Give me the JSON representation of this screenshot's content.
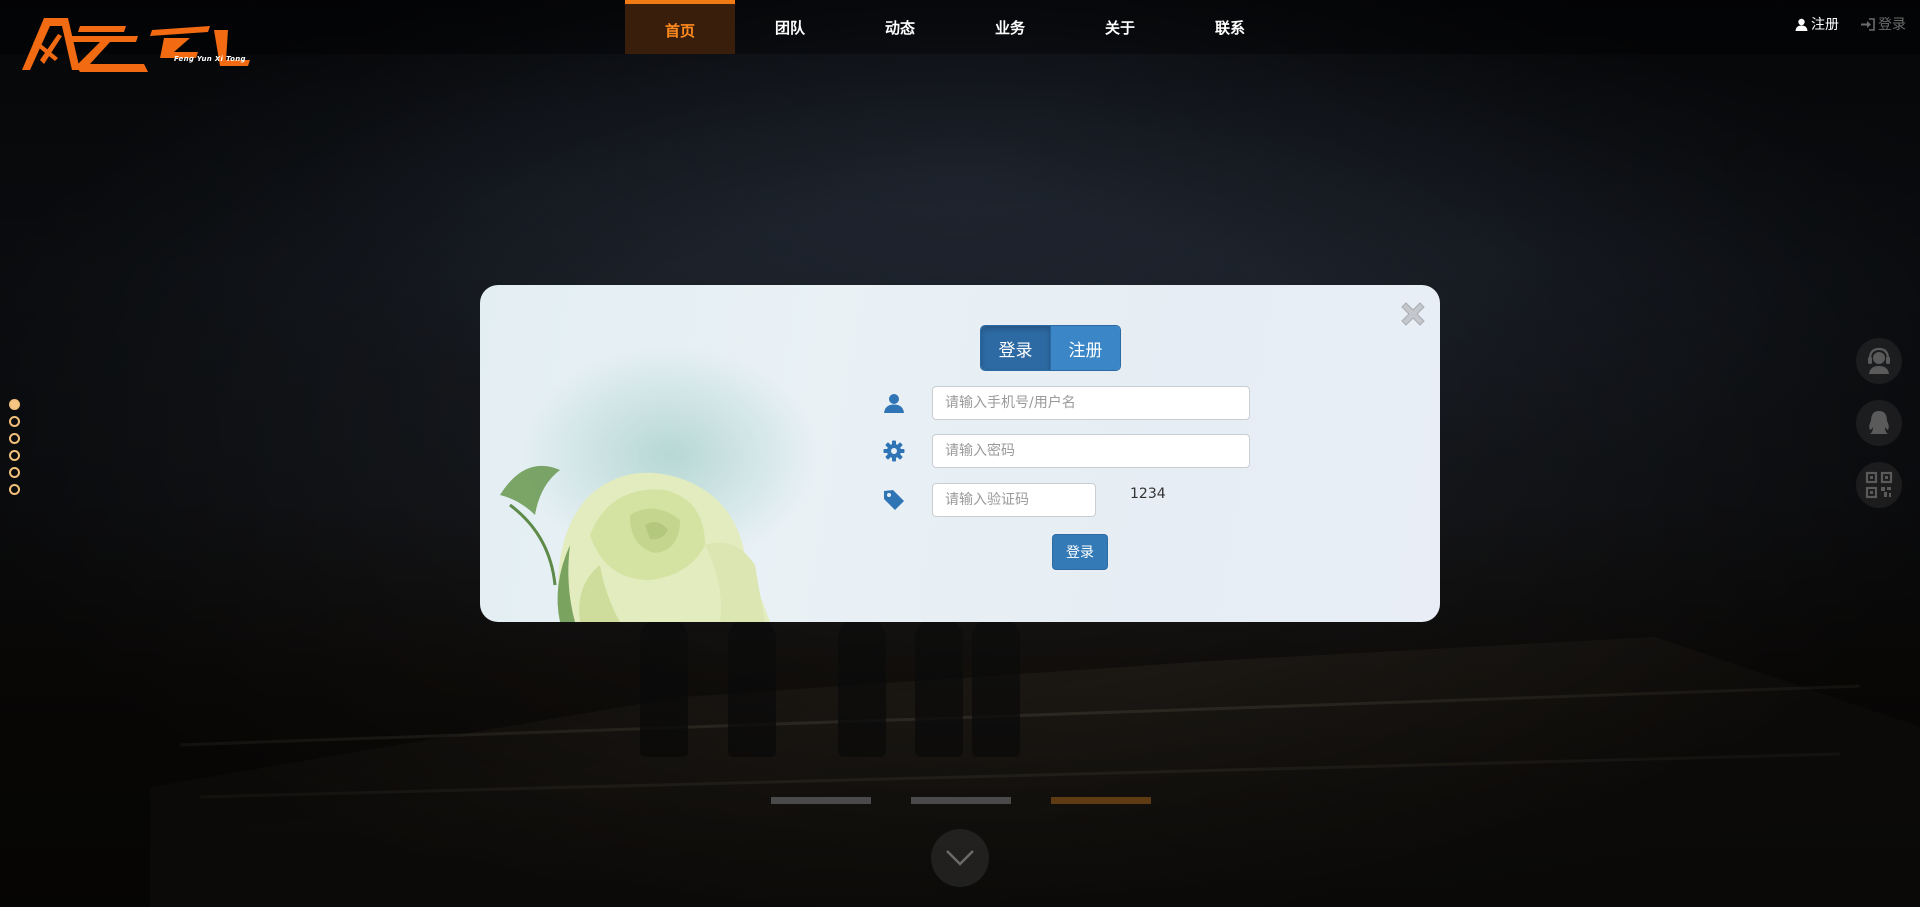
{
  "logo": {
    "title": "风云系统",
    "subtitle": "Feng Yun Xi Tong"
  },
  "nav": {
    "items": [
      {
        "label": "首页",
        "active": true
      },
      {
        "label": "团队"
      },
      {
        "label": "动态"
      },
      {
        "label": "业务"
      },
      {
        "label": "关于"
      },
      {
        "label": "联系"
      }
    ]
  },
  "auth": {
    "register_label": "注册",
    "login_label": "登录",
    "register_icon": "user-icon",
    "login_icon": "sign-in-icon"
  },
  "pager": {
    "dots": 6,
    "active_dot": 0,
    "bars": 3,
    "active_bar": 2
  },
  "side_icons": [
    "customer-service-icon",
    "qq-icon",
    "qr-code-icon"
  ],
  "modal": {
    "tabs": [
      {
        "label": "登录",
        "active": true
      },
      {
        "label": "注册"
      }
    ],
    "fields": {
      "username_placeholder": "请输入手机号/用户名",
      "password_placeholder": "请输入密码",
      "captcha_placeholder": "请输入验证码"
    },
    "captcha_value": "1234",
    "submit_label": "登录"
  },
  "colors": {
    "accent": "#f07a14",
    "button_blue": "#337ab7",
    "tab_blue": "#3b86c6",
    "dot": "#f7c684"
  }
}
